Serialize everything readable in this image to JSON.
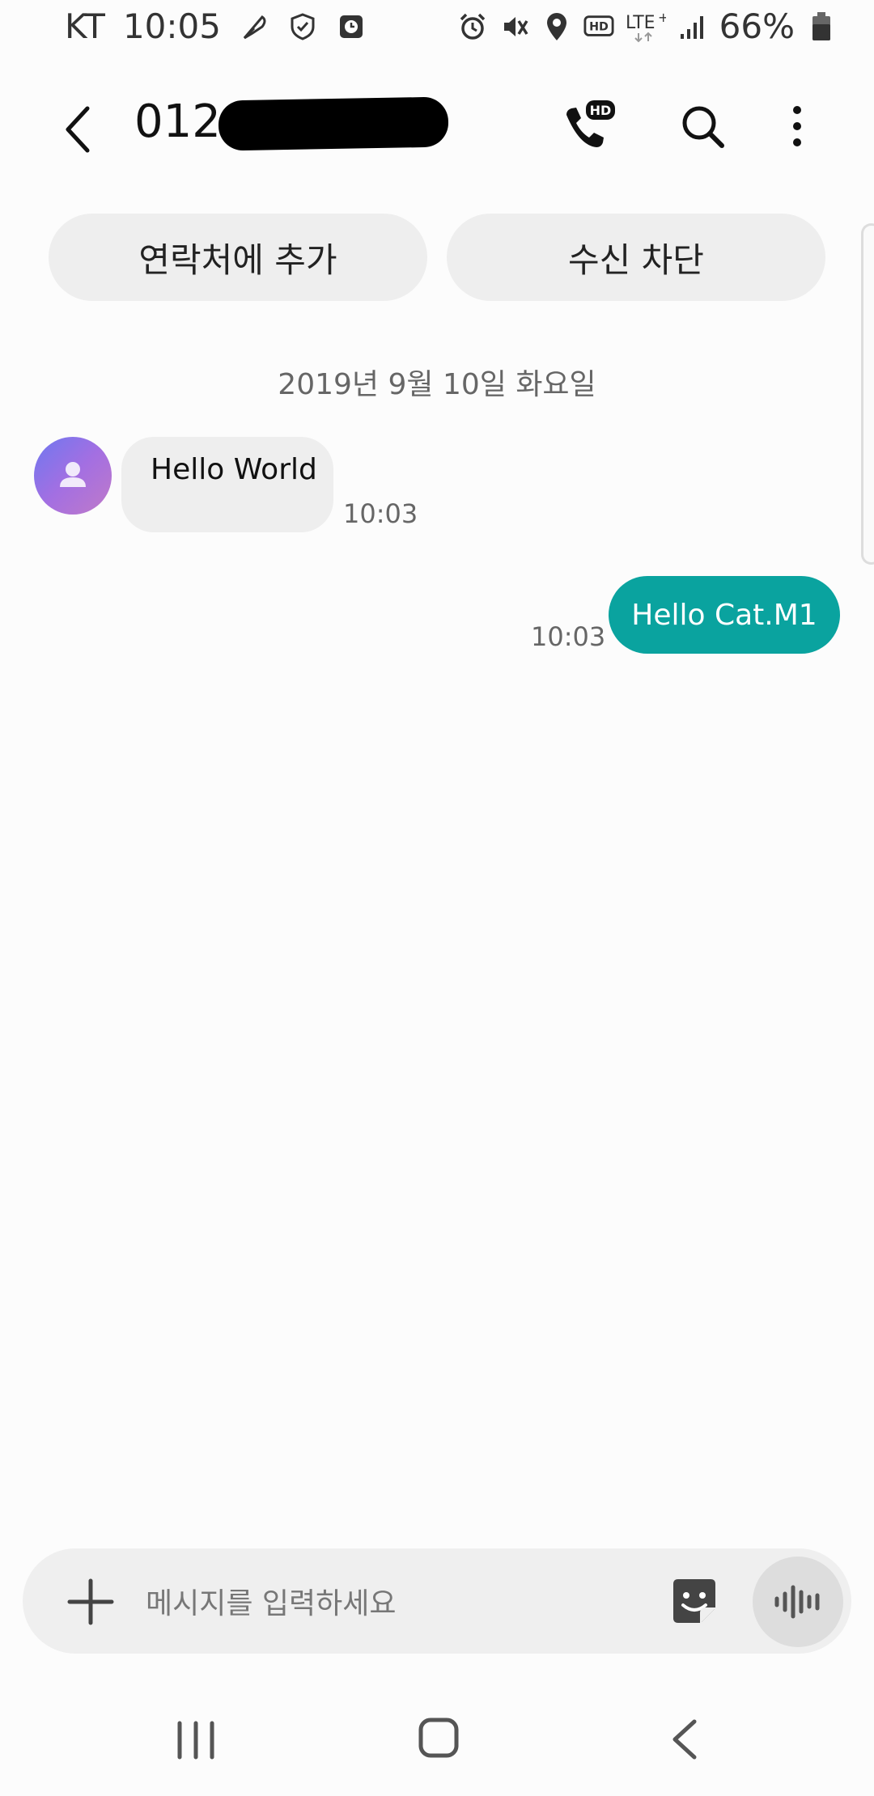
{
  "status_bar": {
    "carrier": "KT",
    "time": "10:05",
    "battery_percent": "66%",
    "network": "LTE+"
  },
  "header": {
    "title": "012-"
  },
  "chips": {
    "add_contact": "연락처에 추가",
    "block": "수신 차단"
  },
  "conversation": {
    "date": "2019년 9월 10일 화요일",
    "messages": [
      {
        "direction": "incoming",
        "text": "Hello World",
        "time": "10:03"
      },
      {
        "direction": "outgoing",
        "text": "Hello Cat.M1",
        "time": "10:03"
      }
    ]
  },
  "composer": {
    "placeholder": "메시지를 입력하세요"
  },
  "colors": {
    "accent": "#0aa39f",
    "bubble_in": "#eeeeee",
    "chip_bg": "#eeeeee"
  },
  "icons": {
    "back": "back-arrow-icon",
    "hd_call": "hd-call-icon",
    "search": "search-icon",
    "more": "more-vertical-icon",
    "attach": "plus-icon",
    "sticker": "sticker-icon",
    "voice": "voice-waveform-icon"
  }
}
